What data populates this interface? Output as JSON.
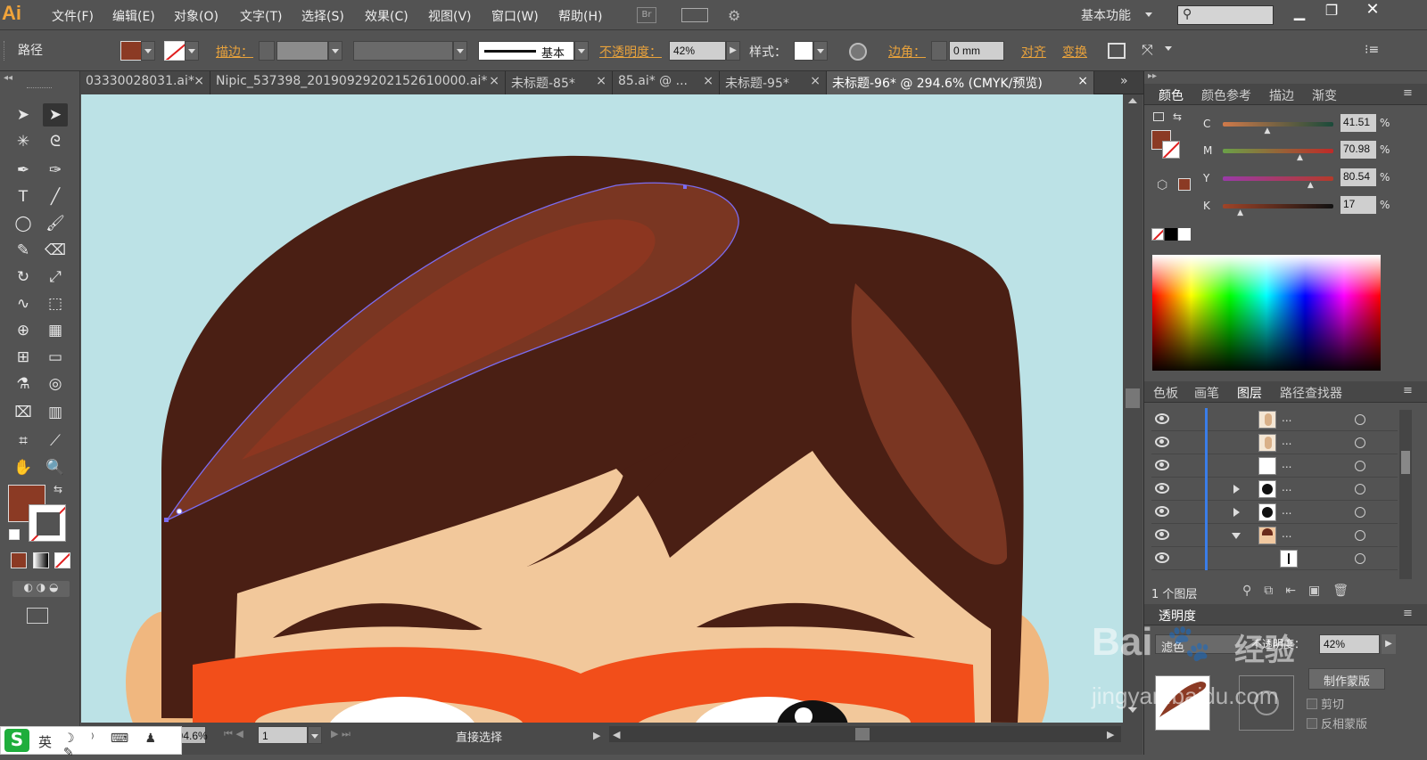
{
  "app": {
    "logo": "Ai",
    "workspace": "基本功能",
    "search_placeholder": ""
  },
  "menu": [
    "文件(F)",
    "编辑(E)",
    "对象(O)",
    "文字(T)",
    "选择(S)",
    "效果(C)",
    "视图(V)",
    "窗口(W)",
    "帮助(H)"
  ],
  "bridge_label": "Br",
  "control": {
    "object_type": "路径",
    "stroke_label": "描边：",
    "stroke_profile": "基本",
    "opacity_label": "不透明度：",
    "opacity_value": "42%",
    "style_label": "样式：",
    "corner_label": "边角：",
    "corner_value": "0 mm",
    "align_label": "对齐",
    "transform_label": "变换"
  },
  "tabs": [
    {
      "label": "03330028031.ai*",
      "active": false
    },
    {
      "label": "Nipic_537398_20190929202152610000.ai*",
      "active": false
    },
    {
      "label": "未标题-85*",
      "active": false
    },
    {
      "label": "85.ai* @ ...",
      "active": false
    },
    {
      "label": "未标题-95*",
      "active": false
    },
    {
      "label": "未标题-96* @ 294.6% (CMYK/预览)",
      "active": true
    }
  ],
  "tab_close": "×",
  "tab_overflow": "»",
  "color_panel": {
    "tabs": [
      "颜色",
      "颜色参考",
      "描边",
      "渐变"
    ],
    "channels": [
      {
        "name": "C",
        "value": "41.51",
        "pct": 0.4151
      },
      {
        "name": "M",
        "value": "70.98",
        "pct": 0.7098
      },
      {
        "name": "Y",
        "value": "80.54",
        "pct": 0.8054
      },
      {
        "name": "K",
        "value": "17",
        "pct": 0.17
      }
    ],
    "percent": "%",
    "fill_color": "#8b3a24"
  },
  "layers_panel": {
    "tabs": [
      "色板",
      "画笔",
      "图层",
      "路径查找器"
    ],
    "footer": "1 个图层",
    "row_dots": "..."
  },
  "transparency_panel": {
    "title": "透明度",
    "mode": "滤色",
    "opacity_label": "不透明度：",
    "opacity_value": "42%",
    "make_mask": "制作蒙版",
    "clip": "剪切",
    "invert": "反相蒙版"
  },
  "status": {
    "zoom": "294.6%",
    "artboard": "1",
    "tool_name": "直接选择"
  },
  "ime": {
    "lang": "英"
  },
  "watermark": {
    "brand": "Bai",
    "brand2": "经验",
    "url": "jingyan.baidu.com"
  }
}
